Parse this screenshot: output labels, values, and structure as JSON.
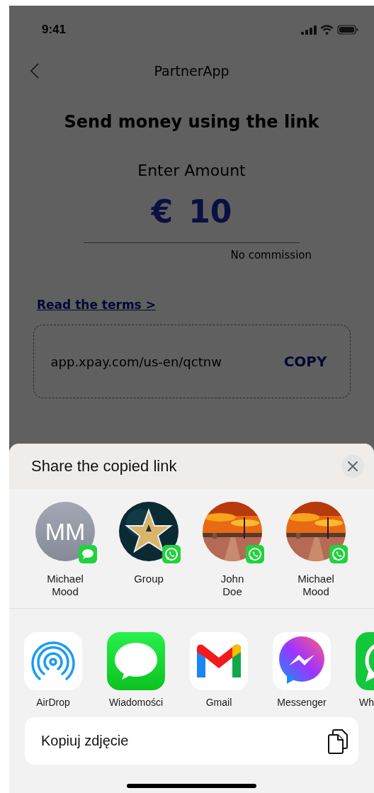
{
  "status_bar": {
    "time": "9:41"
  },
  "nav": {
    "title": "PartnerApp"
  },
  "heading": "Send money using the link",
  "amount": {
    "label": "Enter Amount",
    "currency": "€",
    "value": "10",
    "note": "No commission"
  },
  "terms_link": "Read the terms >",
  "link_box": {
    "url": "app.xpay.com/us-en/qctnw",
    "action": "COPY"
  },
  "share_sheet": {
    "title": "Share the copied link",
    "contacts": [
      {
        "name": "Michael Mood",
        "avatar": {
          "kind": "initials",
          "initials": "MM"
        },
        "badge": {
          "kind": "messages"
        }
      },
      {
        "name": "Group",
        "badge": {
          "kind": "whatsapp"
        }
      },
      {
        "name": "John Doe",
        "badge": {
          "kind": "whatsapp"
        }
      },
      {
        "name": "Michael Mood",
        "badge": {
          "kind": "whatsapp"
        }
      }
    ],
    "apps": [
      {
        "label": "AirDrop",
        "kind": "airdrop"
      },
      {
        "label": "Wiadomości",
        "kind": "messages"
      },
      {
        "label": "Gmail",
        "kind": "gmail"
      },
      {
        "label": "Messenger",
        "kind": "messenger"
      },
      {
        "label": "Wh",
        "kind": "whatsapp"
      }
    ],
    "actions": [
      {
        "label": "Kopiuj zdjęcie",
        "kind": "copy"
      }
    ]
  }
}
